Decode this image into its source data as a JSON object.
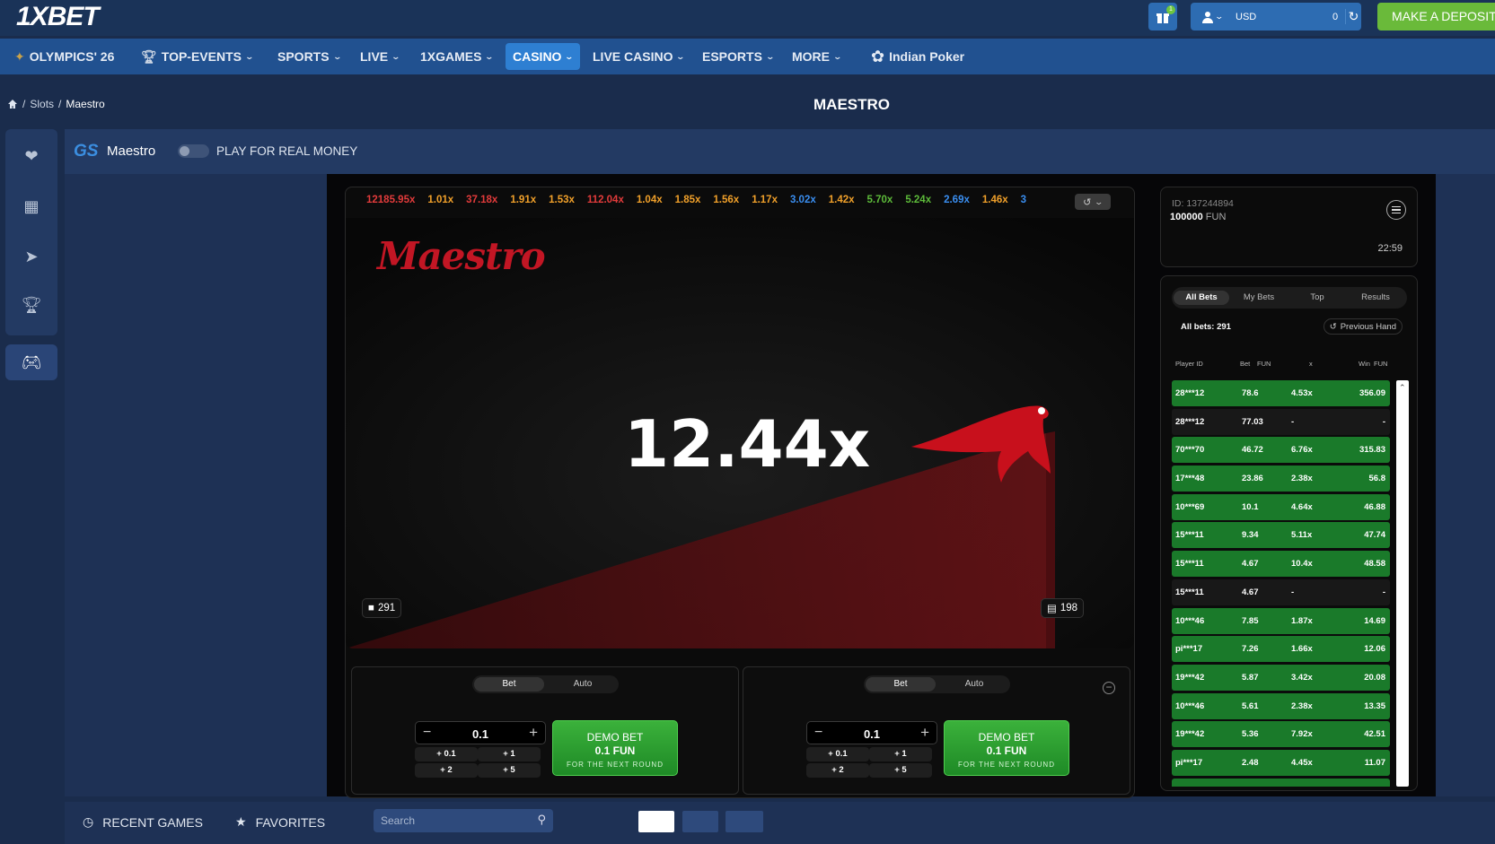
{
  "topbar": {
    "logo": "1XBET",
    "gift_badge": "1",
    "currency": "USD",
    "balance": "0",
    "deposit": "MAKE A DEPOSIT"
  },
  "nav": [
    {
      "label": "OLYMPICS' 26",
      "icon": "laurel-icon"
    },
    {
      "label": "TOP-EVENTS",
      "icon": "trophy-icon"
    },
    {
      "label": "SPORTS"
    },
    {
      "label": "LIVE"
    },
    {
      "label": "1XGAMES"
    },
    {
      "label": "CASINO",
      "active": true
    },
    {
      "label": "LIVE CASINO"
    },
    {
      "label": "ESPORTS"
    },
    {
      "label": "MORE"
    },
    {
      "label": "Indian Poker",
      "icon": "lotus-icon"
    }
  ],
  "breadcrumb": [
    "Slots",
    "Maestro"
  ],
  "page_title": "MAESTRO",
  "game_header": {
    "provider": "GS",
    "name": "Maestro",
    "real_money": "PLAY FOR REAL MONEY"
  },
  "multipliers": [
    {
      "v": "12185.95x",
      "c": "#e23b3b"
    },
    {
      "v": "1.01x",
      "c": "#f0a02a"
    },
    {
      "v": "37.18x",
      "c": "#e23b3b"
    },
    {
      "v": "1.91x",
      "c": "#f0a02a"
    },
    {
      "v": "1.53x",
      "c": "#f0a02a"
    },
    {
      "v": "112.04x",
      "c": "#e23b3b"
    },
    {
      "v": "1.04x",
      "c": "#f0a02a"
    },
    {
      "v": "1.85x",
      "c": "#f0a02a"
    },
    {
      "v": "1.56x",
      "c": "#f0a02a"
    },
    {
      "v": "1.17x",
      "c": "#f0a02a"
    },
    {
      "v": "3.02x",
      "c": "#3a8ef0"
    },
    {
      "v": "1.42x",
      "c": "#f0a02a"
    },
    {
      "v": "5.70x",
      "c": "#5dbb3a"
    },
    {
      "v": "5.24x",
      "c": "#5dbb3a"
    },
    {
      "v": "2.69x",
      "c": "#3a8ef0"
    },
    {
      "v": "1.46x",
      "c": "#f0a02a"
    },
    {
      "v": "3",
      "c": "#3a8ef0"
    }
  ],
  "game": {
    "logo": "Maestro",
    "multiplier": "12.44x",
    "players": "291",
    "bets_icon_count": "198"
  },
  "bet_panels": [
    {
      "tab_on": "Bet",
      "tab_off": "Auto",
      "amount": "0.1",
      "q1": "+ 0.1",
      "q2": "+ 1",
      "q3": "+ 2",
      "q4": "+ 5",
      "btn1": "DEMO BET",
      "btn2": "0.1  FUN",
      "btn3": "FOR THE NEXT ROUND"
    },
    {
      "tab_on": "Bet",
      "tab_off": "Auto",
      "amount": "0.1",
      "q1": "+ 0.1",
      "q2": "+ 1",
      "q3": "+ 2",
      "q4": "+ 5",
      "btn1": "DEMO BET",
      "btn2": "0.1  FUN",
      "btn3": "FOR THE NEXT ROUND"
    }
  ],
  "account": {
    "id": "ID: 137244894",
    "balance": "100000",
    "unit": "FUN",
    "time": "22:59"
  },
  "bets_tabs": [
    "All Bets",
    "My Bets",
    "Top",
    "Results"
  ],
  "all_bets_label": "All bets: 291",
  "previous_hand": "Previous Hand",
  "table_headers": {
    "player": "Player ID",
    "bet": "Bet",
    "bet_unit": "FUN",
    "x": "x",
    "win": "Win",
    "win_unit": "FUN"
  },
  "bets": [
    {
      "p": "28***12",
      "b": "78.6",
      "x": "4.53x",
      "w": "356.09",
      "win": true
    },
    {
      "p": "28***12",
      "b": "77.03",
      "x": "-",
      "w": "-",
      "win": false
    },
    {
      "p": "70***70",
      "b": "46.72",
      "x": "6.76x",
      "w": "315.83",
      "win": true
    },
    {
      "p": "17***48",
      "b": "23.86",
      "x": "2.38x",
      "w": "56.8",
      "win": true
    },
    {
      "p": "10***69",
      "b": "10.1",
      "x": "4.64x",
      "w": "46.88",
      "win": true
    },
    {
      "p": "15***11",
      "b": "9.34",
      "x": "5.11x",
      "w": "47.74",
      "win": true
    },
    {
      "p": "15***11",
      "b": "4.67",
      "x": "10.4x",
      "w": "48.58",
      "win": true
    },
    {
      "p": "15***11",
      "b": "4.67",
      "x": "-",
      "w": "-",
      "win": false
    },
    {
      "p": "10***46",
      "b": "7.85",
      "x": "1.87x",
      "w": "14.69",
      "win": true
    },
    {
      "p": "pi***17",
      "b": "7.26",
      "x": "1.66x",
      "w": "12.06",
      "win": true
    },
    {
      "p": "19***42",
      "b": "5.87",
      "x": "3.42x",
      "w": "20.08",
      "win": true
    },
    {
      "p": "10***46",
      "b": "5.61",
      "x": "2.38x",
      "w": "13.35",
      "win": true
    },
    {
      "p": "19***42",
      "b": "5.36",
      "x": "7.92x",
      "w": "42.51",
      "win": true
    },
    {
      "p": "pi***17",
      "b": "2.48",
      "x": "4.45x",
      "w": "11.07",
      "win": true
    },
    {
      "p": "",
      "b": "",
      "x": "",
      "w": "",
      "win": true
    }
  ],
  "bottom": {
    "recent": "RECENT GAMES",
    "favorites": "FAVORITES",
    "search_placeholder": "Search"
  }
}
